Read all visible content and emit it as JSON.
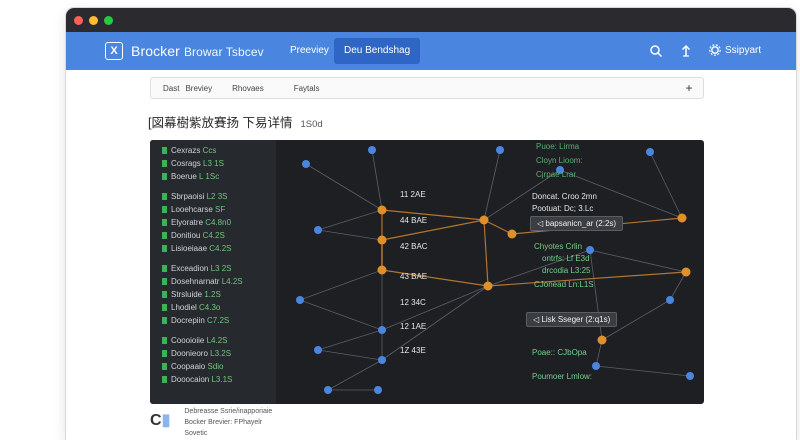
{
  "window": {
    "traffic_lights": [
      "#ff5f57",
      "#febc2e",
      "#28c840"
    ]
  },
  "app": {
    "logo_glyph": "X",
    "title": "Brocker",
    "subtitle": "Browar Tsbcev",
    "nav": [
      {
        "label": "Preeviey",
        "active": false
      },
      {
        "label": "Deu Bendshag",
        "active": true
      }
    ],
    "icons": [
      "search-icon",
      "upload-icon",
      "gear-icon"
    ],
    "support_label": "Ssipyart",
    "accent": "#4a86e0"
  },
  "tabs": {
    "items": [
      "Dast",
      "Breviey",
      "Rhovaes",
      "Faytals"
    ],
    "add_label": "+"
  },
  "page": {
    "heading": "[図幕樹紫放賽扬 下易详情",
    "heading_code": "1S0d"
  },
  "panel": {
    "list": [
      {
        "label": "Cexrazs",
        "value": "Ccs"
      },
      {
        "label": "Cosrags",
        "value": "L3 1S"
      },
      {
        "label": "Boerue",
        "value": "L 1Sc"
      },
      {
        "label": "Sbrpaoisi",
        "value": "L2 3S"
      },
      {
        "label": "Looehcarse",
        "value": "SF"
      },
      {
        "label": "Elyoratre",
        "value": "C4.8n0"
      },
      {
        "label": "Donitiou",
        "value": "C4.2S"
      },
      {
        "label": "Lisioeiaae",
        "value": "C4.2S"
      },
      {
        "label": "Exceadion",
        "value": "L3 2S"
      },
      {
        "label": "Dosehnarnatr",
        "value": "L4.2S"
      },
      {
        "label": "Strsluide",
        "value": "1.2S"
      },
      {
        "label": "Lhodiel",
        "value": "C4.3o"
      },
      {
        "label": "Docrepiin",
        "value": "C7.2S"
      },
      {
        "label": "Coooioiie",
        "value": "L4.2S"
      },
      {
        "label": "Doonieoro",
        "value": "L3.2S"
      },
      {
        "label": "Coopaaio",
        "value": "Sdio"
      },
      {
        "label": "Dooocaion",
        "value": "L3.1S"
      }
    ],
    "node_labels": [
      "11 2AE",
      "44 BAE",
      "42 BAC",
      "43 BAE",
      "12 34C",
      "12 1AE",
      "1Z 43E"
    ],
    "right_text": [
      "Puoe: Lirma",
      "Cloyn Lioom:",
      "Cjrpae Lrar",
      "Doncat. Croo 2mn",
      "Pootuat: Dc; 3.Lc"
    ],
    "green_text": [
      "Chyotes Crlin",
      "ontrfs: Lf E3d",
      "drcodia L3:25",
      "CJonead Ln:L1S",
      "Poae:: CJbOpa",
      "Poumoer Lmlow:"
    ],
    "tooltips": [
      "bapsanicn_ar (2:2s)",
      "Lisk Sseger (2:q1s)"
    ],
    "node_colors": [
      "#e0902a",
      "#4a86e0"
    ]
  },
  "footer": {
    "logo_glyph": "C",
    "line1": "Debreasse Ssrie/inapporiaie",
    "line2": "Bocker Brevier: FPhayelr",
    "line3": "Sovetic"
  }
}
